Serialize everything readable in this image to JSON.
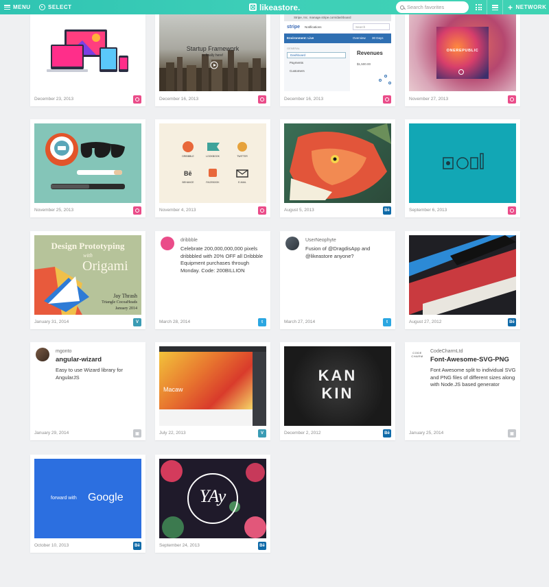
{
  "header": {
    "menu_label": "MENU",
    "select_label": "SELECT",
    "logo_text": "likeastore.",
    "search_placeholder": "Search favorites",
    "network_label": "NETWORK"
  },
  "cards": [
    {
      "date": "December 23, 2013",
      "source": "dribbble"
    },
    {
      "date": "December 16, 2013",
      "source": "dribbble",
      "thumb_title": "Startup Framework",
      "thumb_sub": "is finally here!"
    },
    {
      "date": "December 16, 2013",
      "source": "dribbble",
      "thumb_heading": "Revenues",
      "thumb_value": "$1,500.00",
      "thumb_env": "Environment: Live",
      "thumb_menu": [
        "Dashboard",
        "Payments",
        "Customers"
      ],
      "thumb_nav": [
        "Notifications",
        "Overview",
        "30 Days"
      ],
      "thumb_url": "Stripe, Inc. manage.stripe.com/dashboard",
      "thumb_general": "GENERAL",
      "thumb_search": "Search",
      "thumb_brand": "stripe"
    },
    {
      "date": "November 27, 2013",
      "source": "dribbble",
      "thumb_title": "ONEREPUBLIC"
    },
    {
      "date": "November 25, 2013",
      "source": "dribbble"
    },
    {
      "date": "November 4, 2013",
      "source": "dribbble",
      "thumb_labels": [
        "DRIBBBLE",
        "LOOKBOOK",
        "TWITTER",
        "BEHANCE",
        "FACEBOOK",
        "E-MAIL"
      ]
    },
    {
      "date": "August 5, 2013",
      "source": "behance"
    },
    {
      "date": "September 6, 2013",
      "source": "dribbble"
    },
    {
      "date": "January 31, 2014",
      "source": "vimeo",
      "thumb_title": "Design Prototyping",
      "thumb_with": "with",
      "thumb_big": "Origami",
      "thumb_author": "Jay Thrash",
      "thumb_event": "Triangle CocoaHeads",
      "thumb_when": "January 2014"
    },
    {
      "date": "March 28, 2014",
      "source": "twitter",
      "user": "dribbble",
      "text": "Celebrate 200,000,000,000 pixels dribbbled with 20% OFF all Dribbble Equipment purchases through Monday. Code: 200BILLION"
    },
    {
      "date": "March 27, 2014",
      "source": "twitter",
      "user": "UserNeophyte",
      "text": "Fusion of @DragdisApp and @likeastore anyone?"
    },
    {
      "date": "August 27, 2012",
      "source": "behance"
    },
    {
      "date": "January 29, 2014",
      "source": "github",
      "user": "mgonto",
      "title": "angular-wizard",
      "text": "Easy to use Wizard library for AngularJS"
    },
    {
      "date": "July 22, 2013",
      "source": "vimeo",
      "thumb_title": "Macaw"
    },
    {
      "date": "December 2, 2012",
      "source": "behance",
      "thumb_title": "KAN KIN"
    },
    {
      "date": "January 25, 2014",
      "source": "github",
      "user": "CodeCharmLtd",
      "title": "Font-Awesome-SVG-PNG",
      "text": "Font Awesome split to individual SVG and PNG files of different sizes along with Node.JS based generator",
      "avatar_text": "CODE CHARM"
    },
    {
      "date": "October 10, 2013",
      "source": "behance",
      "thumb_pre": "forward with",
      "thumb_brand": "Google"
    },
    {
      "date": "September 24, 2013",
      "source": "behance",
      "thumb_title": "YAy"
    }
  ],
  "badges": {
    "dribbble": "",
    "behance": "Bē",
    "vimeo": "V",
    "twitter": "t",
    "github": "▣"
  },
  "colors": {
    "accent": "#3ecfb8",
    "dribbble": "#ea4c89",
    "behance": "#0f6aa8",
    "vimeo": "#3a9bb4",
    "twitter": "#2ba6e1"
  }
}
